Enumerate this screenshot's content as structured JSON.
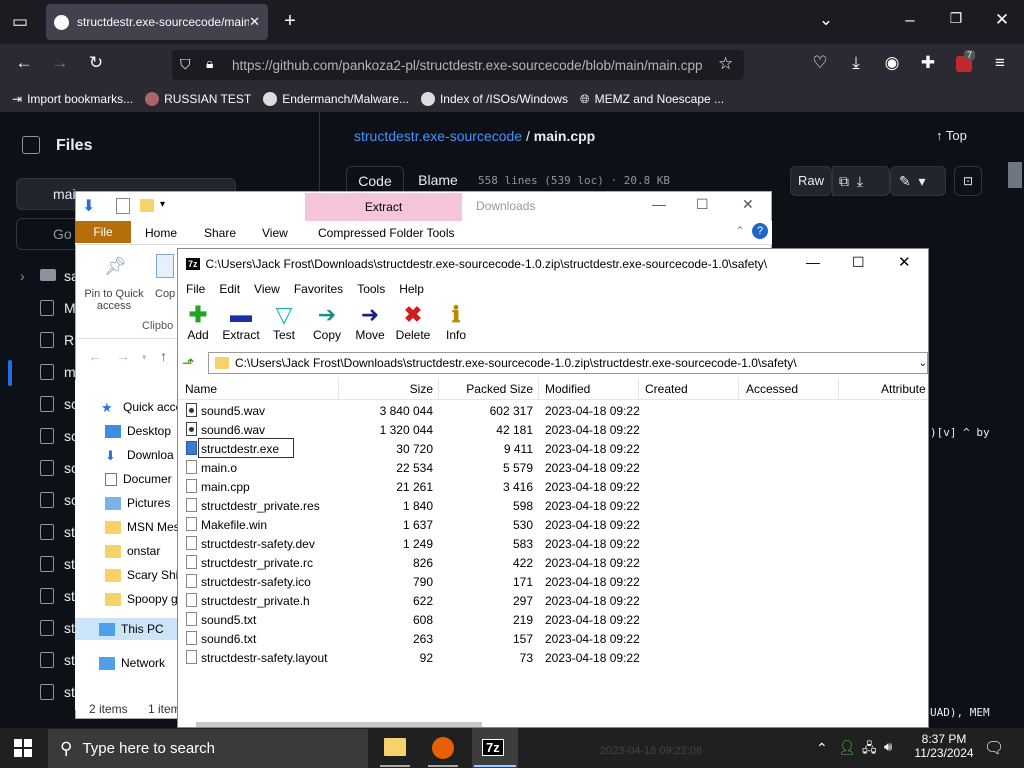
{
  "firefox": {
    "tab_title": "structdestr.exe-sourcecode/main.cpp",
    "url": "https://github.com/pankoza2-pl/structdestr.exe-sourcecode/blob/main/main.cpp",
    "badge_count": "7",
    "bookmarks": [
      "Import bookmarks...",
      "RUSSIAN TEST",
      "Endermanch/Malware...",
      "Index of /ISOs/Windows",
      "MEMZ and Noescape ..."
    ]
  },
  "github": {
    "files_title": "Files",
    "branch": "main",
    "go_placeholder": "Go",
    "path_repo": "structdestr.exe-sourcecode",
    "path_sep": "/",
    "path_file": "main.cpp",
    "top_label": "Top",
    "code_tab": "Code",
    "blame_tab": "Blame",
    "file_meta": "558 lines (539 loc) · 20.8 KB",
    "raw_label": "Raw",
    "side_items": [
      "sa",
      "M",
      "Rl",
      "m",
      "sc",
      "sc",
      "sc",
      "sc",
      "st",
      "st",
      "st",
      "st",
      "st",
      "st",
      "st"
    ],
    "code_fragment_1": ")[v] ^ by",
    "code_fragment_2": "UAD), MEM"
  },
  "explorer": {
    "title_tab": "Extract",
    "title_right": "Downloads",
    "ribbon_tabs": [
      "File",
      "Home",
      "Share",
      "View",
      "Compressed Folder Tools"
    ],
    "pin_label": "Pin to Quick access",
    "copy_label": "Cop",
    "clipboard_label": "Clipbo",
    "nav_items": [
      "Quick acce",
      "Desktop",
      "Downloa",
      "Documer",
      "Pictures",
      "MSN Mes",
      "onstar",
      "Scary Shi",
      "Spoopy g",
      "This PC",
      "Network"
    ],
    "status_items": "2 items",
    "status_items2": "1 item"
  },
  "sevenzip": {
    "title": "C:\\Users\\Jack Frost\\Downloads\\structdestr.exe-sourcecode-1.0.zip\\structdestr.exe-sourcecode-1.0\\safety\\",
    "address": "C:\\Users\\Jack Frost\\Downloads\\structdestr.exe-sourcecode-1.0.zip\\structdestr.exe-sourcecode-1.0\\safety\\",
    "menu": [
      "File",
      "Edit",
      "View",
      "Favorites",
      "Tools",
      "Help"
    ],
    "toolbar": [
      "Add",
      "Extract",
      "Test",
      "Copy",
      "Move",
      "Delete",
      "Info"
    ],
    "columns": [
      "Name",
      "Size",
      "Packed Size",
      "Modified",
      "Created",
      "Accessed",
      "Attribute"
    ],
    "files": [
      {
        "name": "sound5.wav",
        "size": "3 840 044",
        "packed": "602 317",
        "modified": "2023-04-18 09:22",
        "type": "wav"
      },
      {
        "name": "sound6.wav",
        "size": "1 320 044",
        "packed": "42 181",
        "modified": "2023-04-18 09:22",
        "type": "wav"
      },
      {
        "name": "structdestr.exe",
        "size": "30 720",
        "packed": "9 411",
        "modified": "2023-04-18 09:22",
        "type": "exe"
      },
      {
        "name": "main.o",
        "size": "22 534",
        "packed": "5 579",
        "modified": "2023-04-18 09:22",
        "type": "file"
      },
      {
        "name": "main.cpp",
        "size": "21 261",
        "packed": "3 416",
        "modified": "2023-04-18 09:22",
        "type": "file"
      },
      {
        "name": "structdestr_private.res",
        "size": "1 840",
        "packed": "598",
        "modified": "2023-04-18 09:22",
        "type": "file"
      },
      {
        "name": "Makefile.win",
        "size": "1 637",
        "packed": "530",
        "modified": "2023-04-18 09:22",
        "type": "file"
      },
      {
        "name": "structdestr-safety.dev",
        "size": "1 249",
        "packed": "583",
        "modified": "2023-04-18 09:22",
        "type": "file"
      },
      {
        "name": "structdestr_private.rc",
        "size": "826",
        "packed": "422",
        "modified": "2023-04-18 09:22",
        "type": "file"
      },
      {
        "name": "structdestr-safety.ico",
        "size": "790",
        "packed": "171",
        "modified": "2023-04-18 09:22",
        "type": "file"
      },
      {
        "name": "structdestr_private.h",
        "size": "622",
        "packed": "297",
        "modified": "2023-04-18 09:22",
        "type": "file"
      },
      {
        "name": "sound5.txt",
        "size": "608",
        "packed": "219",
        "modified": "2023-04-18 09:22",
        "type": "file"
      },
      {
        "name": "sound6.txt",
        "size": "263",
        "packed": "157",
        "modified": "2023-04-18 09:22",
        "type": "file"
      },
      {
        "name": "structdestr-safety.layout",
        "size": "92",
        "packed": "73",
        "modified": "2023-04-18 09:22",
        "type": "file"
      }
    ]
  },
  "taskbar": {
    "search_placeholder": "Type here to search",
    "time": "8:37 PM",
    "date": "11/23/2024",
    "ghost_text": "2023-04-18 09:22:08"
  }
}
